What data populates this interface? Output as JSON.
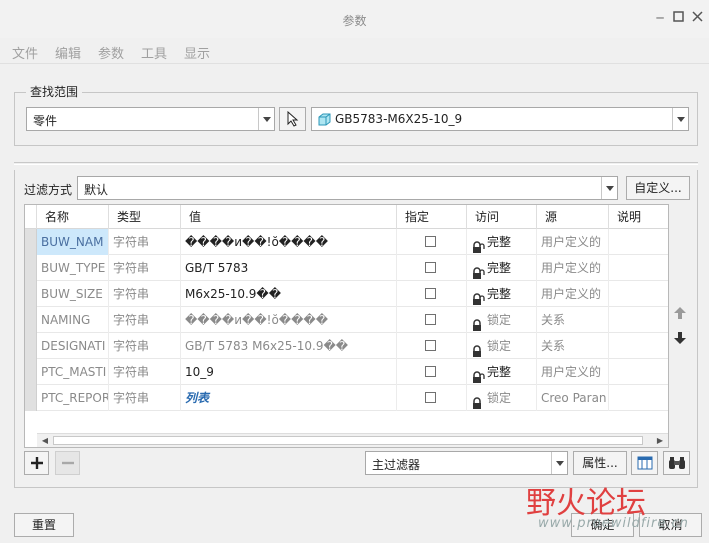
{
  "window": {
    "title": "参数"
  },
  "menu": [
    "文件",
    "编辑",
    "参数",
    "工具",
    "显示"
  ],
  "search": {
    "group_title": "查找范围",
    "scope_value": "零件",
    "model_value": "GB5783-M6X25-10_9"
  },
  "filter": {
    "label": "过滤方式",
    "value": "默认",
    "customize_label": "自定义..."
  },
  "table": {
    "columns": [
      "名称",
      "类型",
      "值",
      "指定",
      "访问",
      "源",
      "说明"
    ],
    "rows": [
      {
        "name": "BUW_NAM",
        "type": "字符串",
        "value": "����и��!ŏ����",
        "access": "完整",
        "source": "用户定义的",
        "locked": false,
        "enabled": true
      },
      {
        "name": "BUW_TYPE",
        "type": "字符串",
        "value": "GB/T 5783",
        "access": "完整",
        "source": "用户定义的",
        "locked": false,
        "enabled": true
      },
      {
        "name": "BUW_SIZE",
        "type": "字符串",
        "value": "M6x25-10.9��",
        "access": "完整",
        "source": "用户定义的",
        "locked": false,
        "enabled": true
      },
      {
        "name": "NAMING",
        "type": "字符串",
        "value": "����и��!ŏ����",
        "access": "锁定",
        "source": "关系",
        "locked": true,
        "enabled": false
      },
      {
        "name": "DESIGNATI",
        "type": "字符串",
        "value": "GB/T 5783 M6x25-10.9��",
        "access": "锁定",
        "source": "关系",
        "locked": true,
        "enabled": false
      },
      {
        "name": "PTC_MASTI",
        "type": "字符串",
        "value": "10_9",
        "access": "完整",
        "source": "用户定义的",
        "locked": false,
        "enabled": true
      },
      {
        "name": "PTC_REPOR",
        "type": "字符串",
        "value": "列表",
        "access": "锁定",
        "source": "Creo Paran",
        "locked": true,
        "enabled": false,
        "value_style": "link"
      }
    ]
  },
  "bottom_bar": {
    "main_filter": "主过滤器",
    "properties_label": "属性..."
  },
  "footer": {
    "reset_label": "重置",
    "ok_label": "确定",
    "cancel_label": "取消"
  },
  "watermark": {
    "cn": "野火论坛",
    "url": "www.proewildfire.cn"
  }
}
